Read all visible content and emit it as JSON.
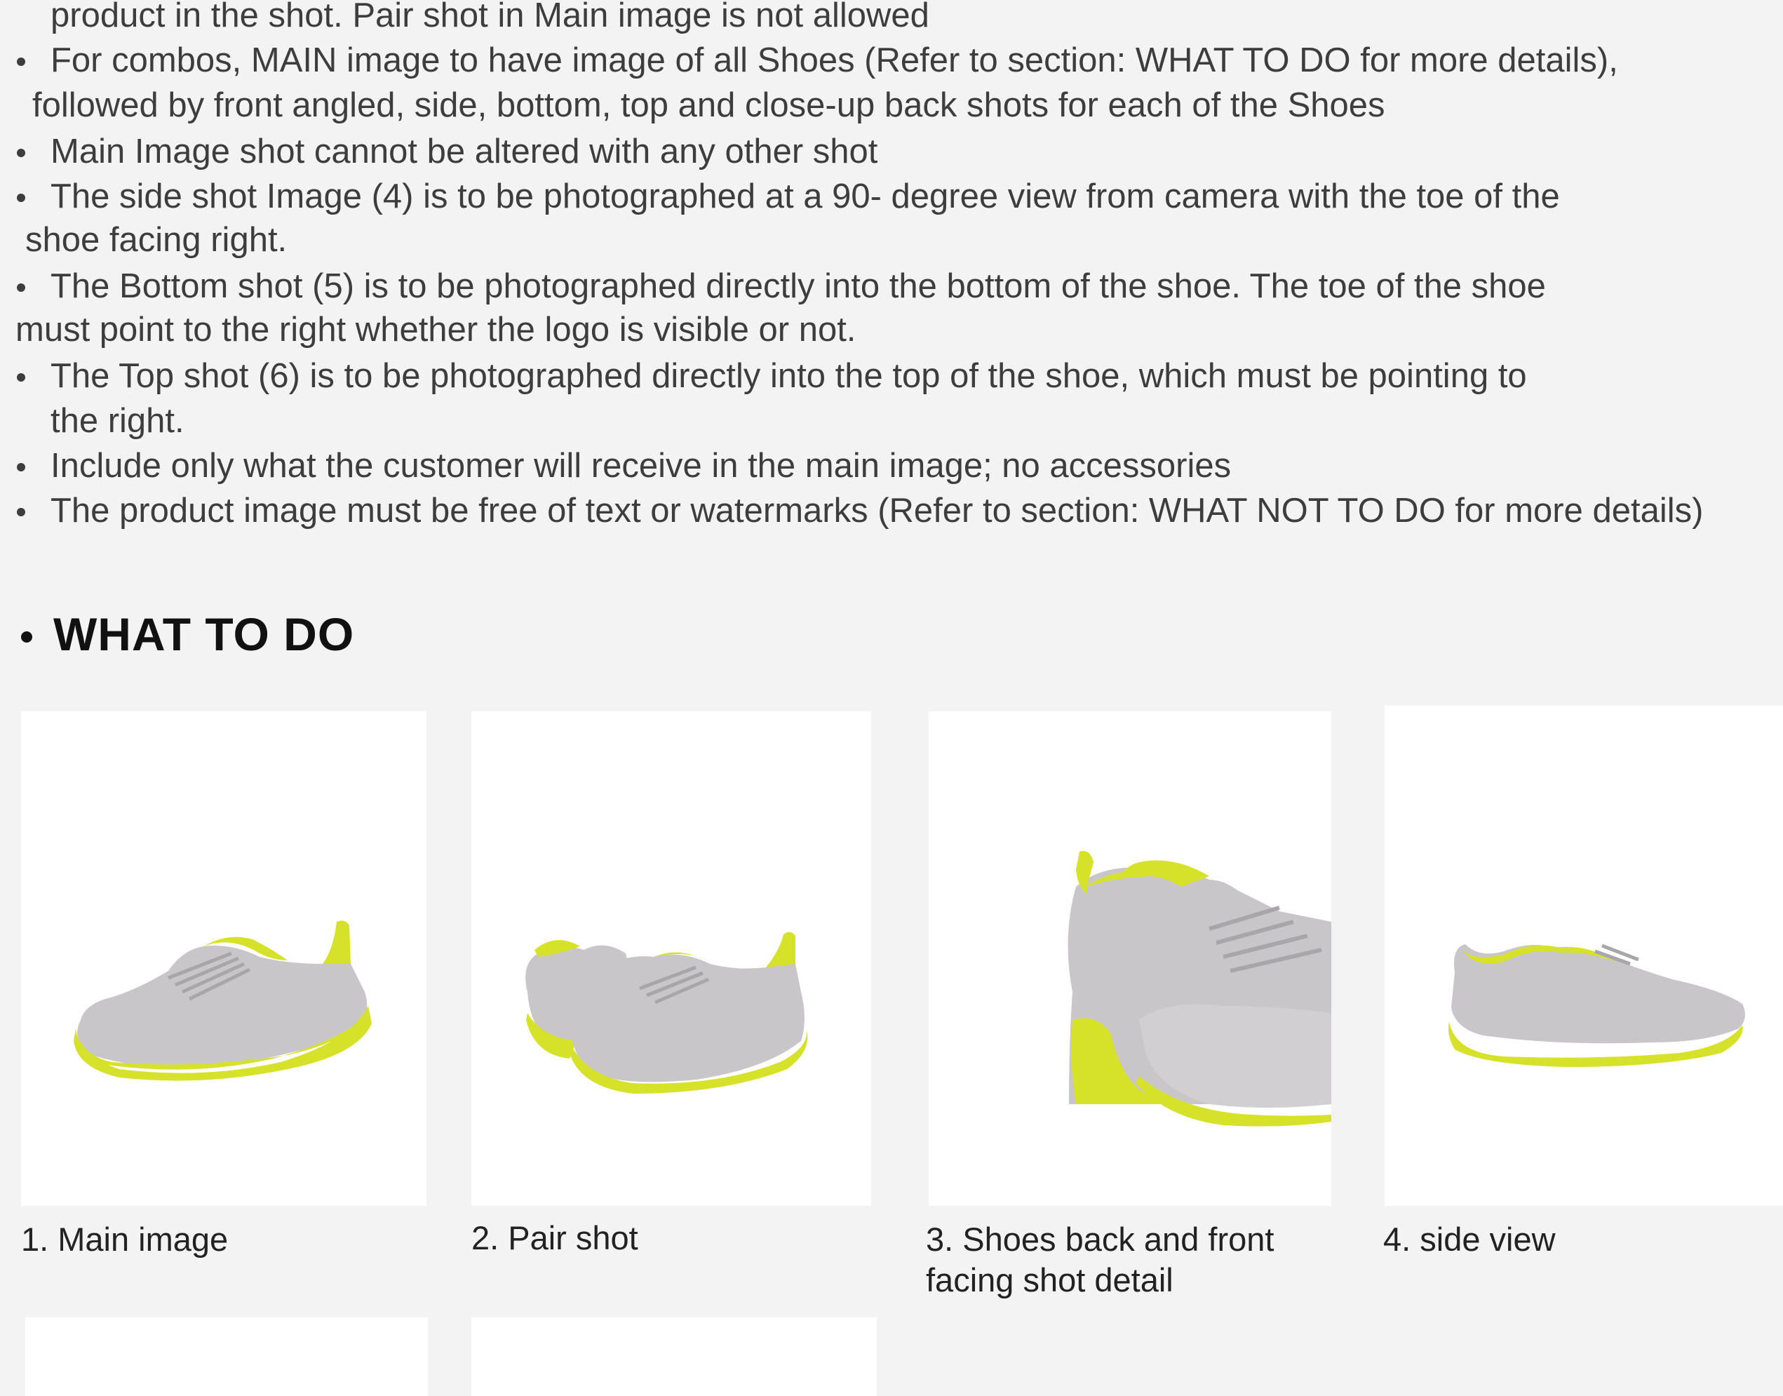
{
  "rules": {
    "lines": [
      "product in the shot. Pair shot in Main image is not allowed",
      "For combos, MAIN image to have image of all Shoes (Refer to section: WHAT TO DO for more details),",
      "followed by front angled, side, bottom, top and close-up back shots for each of the Shoes",
      "Main Image shot cannot be altered with any other shot",
      "The side shot Image (4) is to be photographed at a 90- degree view from camera with the toe of the",
      "shoe facing right.",
      "The Bottom shot (5) is to be photographed directly into the bottom of the shoe. The toe of the shoe",
      "must point to the right whether the logo is visible or not.",
      "The Top shot (6) is to be photographed directly into the top of the shoe, which must be pointing to",
      "the right.",
      "Include only what the customer will receive in the main image; no accessories",
      "The product image must be free of text or watermarks (Refer to section: WHAT NOT TO DO for more details)"
    ]
  },
  "section": {
    "heading": "WHAT TO DO"
  },
  "gallery": {
    "captions": [
      "1. Main image",
      "2. Pair shot",
      "3. Shoes back and front facing shot detail",
      "4. side view"
    ]
  },
  "colors": {
    "background": "#f3f3f3",
    "shoe_upper": "#c9c6c9",
    "shoe_accent": "#d6e22a"
  }
}
